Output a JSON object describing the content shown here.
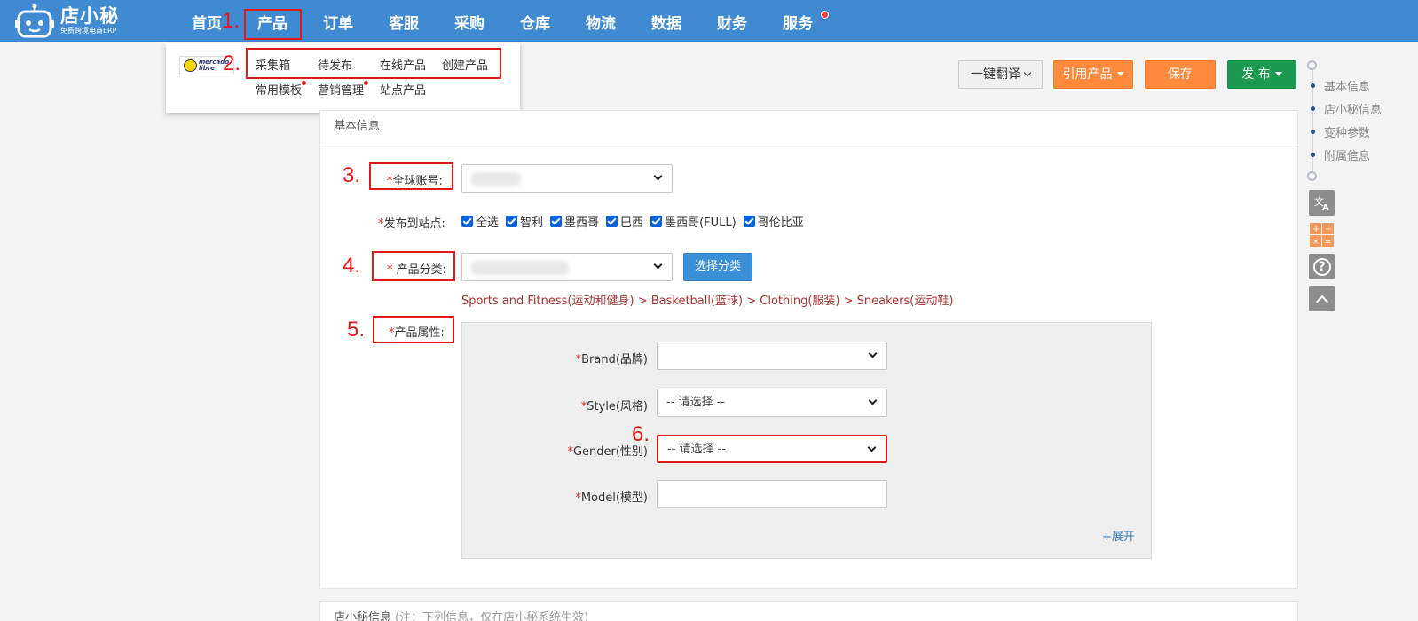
{
  "brand": {
    "name": "店小秘",
    "tagline": "免费跨境电商ERP"
  },
  "nav": [
    {
      "label": "首页"
    },
    {
      "label": "产品"
    },
    {
      "label": "订单"
    },
    {
      "label": "客服"
    },
    {
      "label": "采购"
    },
    {
      "label": "仓库"
    },
    {
      "label": "物流"
    },
    {
      "label": "数据"
    },
    {
      "label": "财务"
    },
    {
      "label": "服务"
    }
  ],
  "annotations": {
    "n1": "1.",
    "n2": "2.",
    "n3": "3.",
    "n4": "4.",
    "n5": "5.",
    "n6": "6."
  },
  "dropdown": {
    "platform_logo_text": "mercado libre",
    "items": [
      "采集箱",
      "待发布",
      "在线产品",
      "创建产品",
      "常用模板",
      "营销管理",
      "站点产品"
    ]
  },
  "toolbar": {
    "translate": "一键翻译",
    "cite": "引用产品",
    "save": "保存",
    "publish": "发 布"
  },
  "anchors": [
    "基本信息",
    "店小秘信息",
    "变种参数",
    "附属信息"
  ],
  "tools": {
    "translate_icon": "translate-icon",
    "calculator_icon": "calculator-icon",
    "help": "?",
    "top_icon": "chevron-up-icon"
  },
  "panel": {
    "title": "基本信息",
    "global_account_label": "全球账号:",
    "sites_label": "发布到站点:",
    "sites": [
      "全选",
      "智利",
      "墨西哥",
      "巴西",
      "墨西哥(FULL)",
      "哥伦比亚"
    ],
    "category_label": "产品分类:",
    "choose_category": "选择分类",
    "category_path": "Sports and Fitness(运动和健身) > Basketball(篮球) > Clothing(服装) > Sneakers(运动鞋)",
    "attributes_label": "产品属性:",
    "attributes": {
      "brand_label": "Brand(品牌)",
      "style_label": "Style(风格)",
      "style_value": "-- 请选择 --",
      "gender_label": "Gender(性别)",
      "gender_value": "-- 请选择 --",
      "model_label": "Model(模型)",
      "expand": "+展开"
    }
  },
  "panel2": {
    "title": "店小秘信息",
    "note": "(注：下列信息，仅在店小秘系统生效)"
  },
  "colors": {
    "topbar": "#3f8ad1",
    "annotation": "#e01a1a",
    "orange": "#ff8a3d",
    "green": "#1d9a52",
    "blue": "#3b8fd4"
  }
}
